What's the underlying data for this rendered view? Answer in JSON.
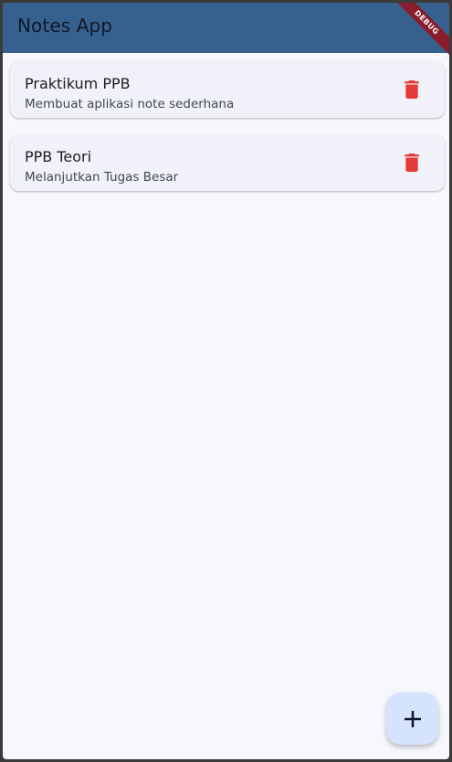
{
  "appbar": {
    "title": "Notes App",
    "color": "#36618e"
  },
  "debug_banner": {
    "label": "DEBUG",
    "color": "#8a1c2b"
  },
  "notes": [
    {
      "title": "Praktikum PPB",
      "description": "Membuat aplikasi note sederhana",
      "action_icon": "trash-icon"
    },
    {
      "title": "PPB Teori",
      "description": "Melanjutkan Tugas Besar",
      "action_icon": "trash-icon"
    }
  ],
  "fab": {
    "icon": "plus-icon",
    "color": "#d6e3ff"
  },
  "colors": {
    "background": "#f7f8fd",
    "card": "#f1f2f9",
    "delete": "#e53935"
  }
}
